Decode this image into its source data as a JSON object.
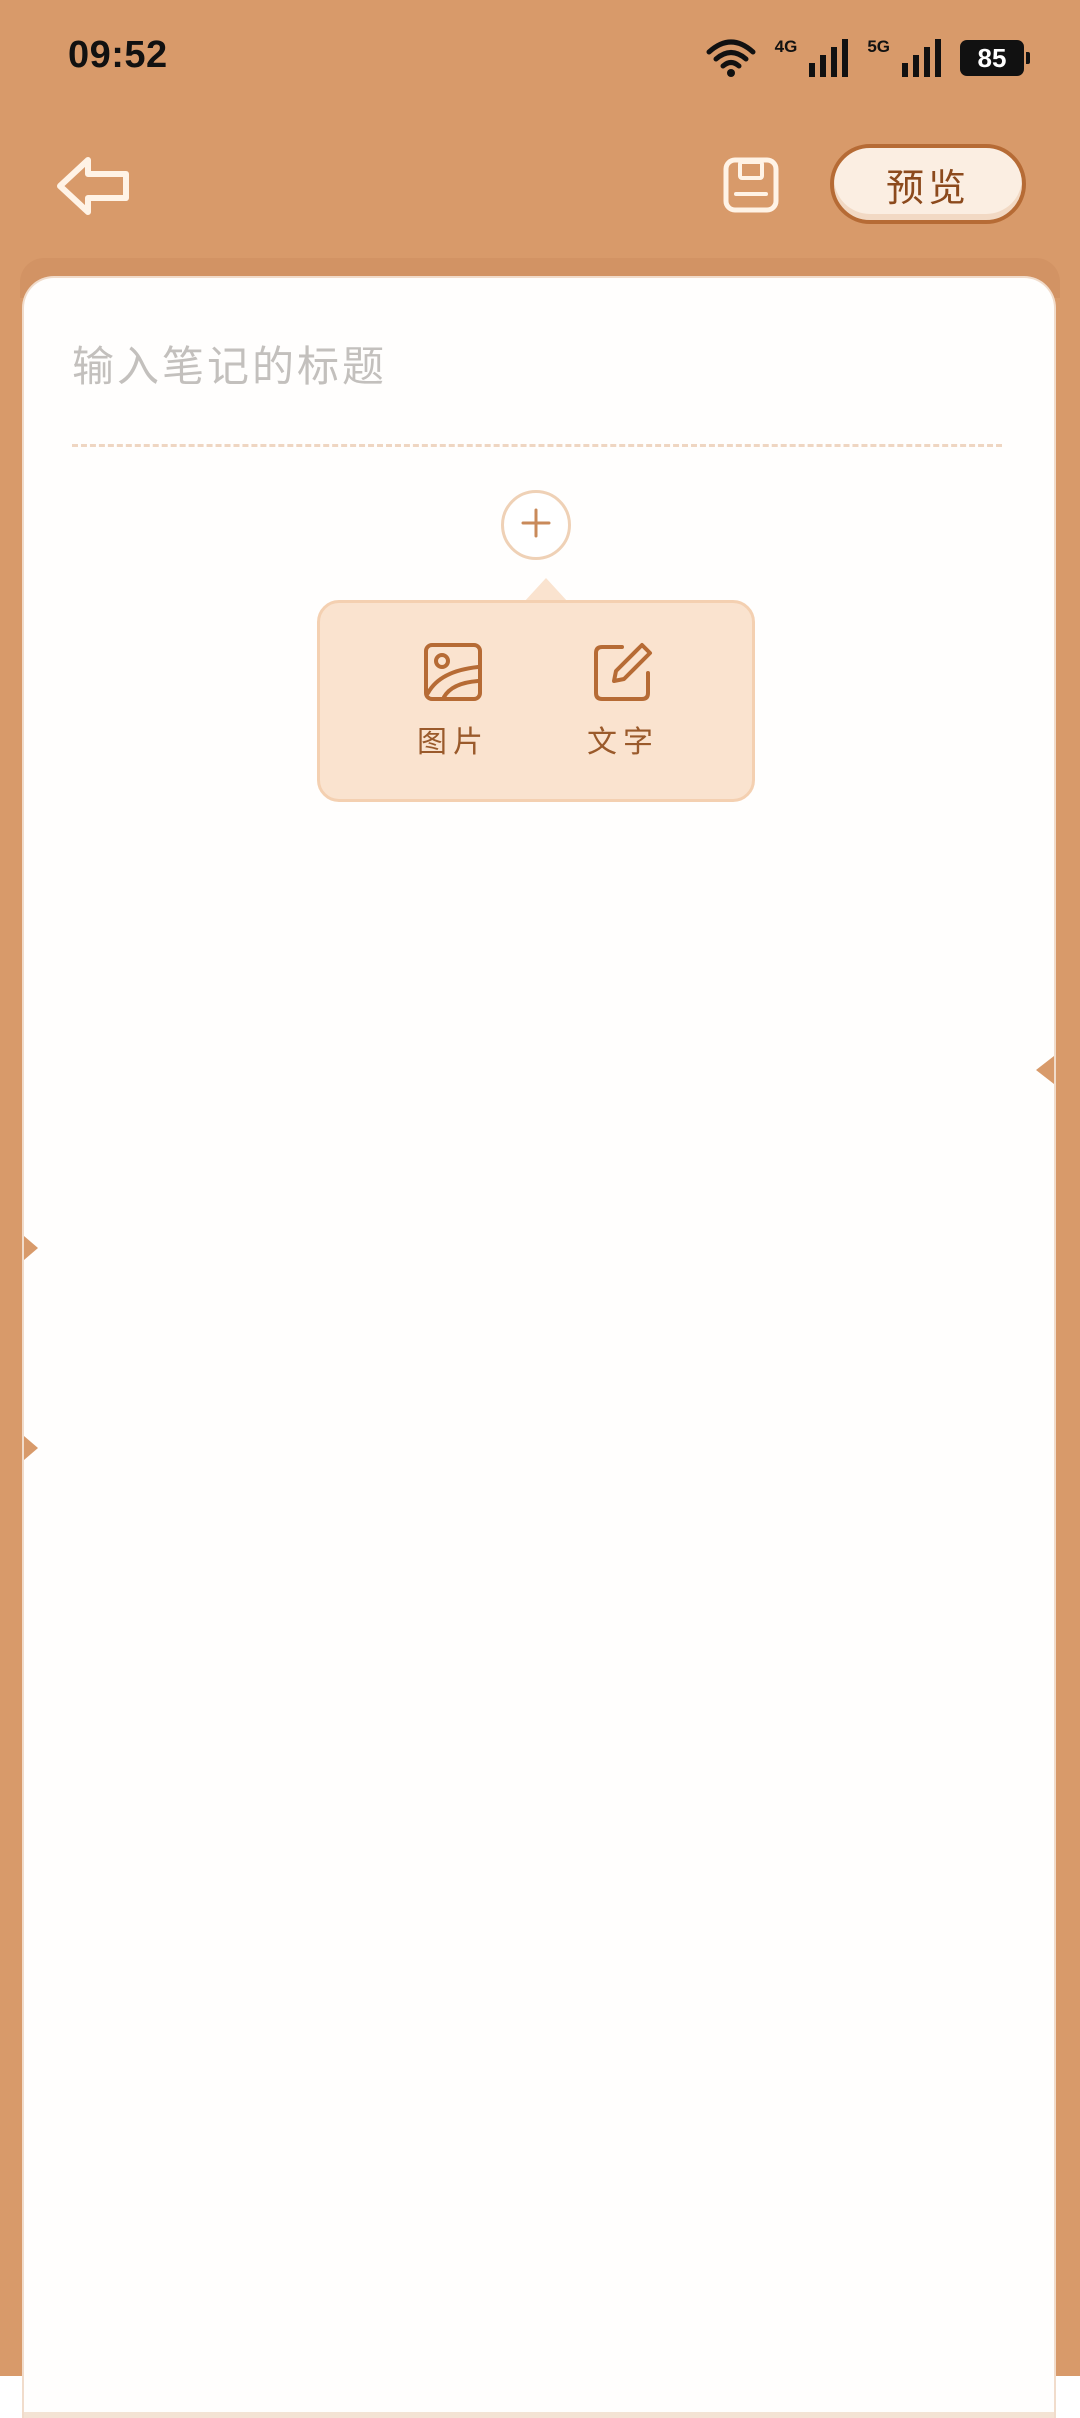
{
  "status_bar": {
    "time": "09:52",
    "network_1": "4G",
    "network_2": "5G",
    "battery": "85"
  },
  "toolbar": {
    "back_icon": "back-arrow-icon",
    "save_icon": "save-disk-icon",
    "preview_label": "预览"
  },
  "editor": {
    "title_placeholder": "输入笔记的标题",
    "add_icon": "plus-icon"
  },
  "insert_menu": {
    "items": [
      {
        "icon": "image-icon",
        "label": "图片"
      },
      {
        "icon": "edit-text-icon",
        "label": "文字"
      }
    ]
  },
  "colors": {
    "background": "#d89a6a",
    "accent": "#b66b35",
    "popover": "#fae3cf",
    "paper": "#fffefd"
  }
}
